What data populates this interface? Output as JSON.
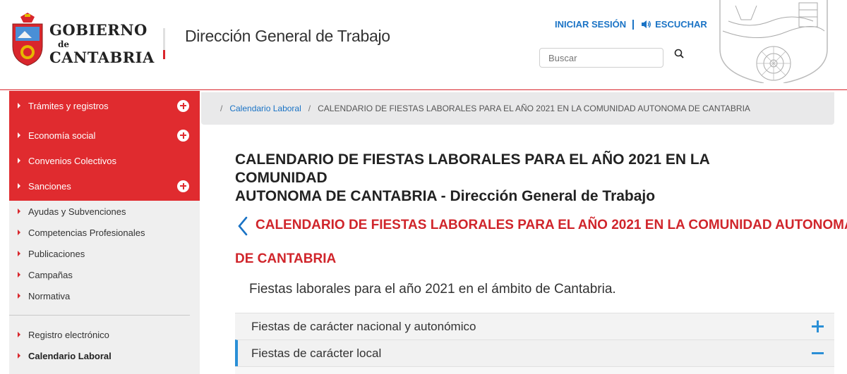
{
  "header": {
    "logo": {
      "line1": "GOBIERNO",
      "line2": "de",
      "line3": "CANTABRIA"
    },
    "department": "Dirección General de Trabajo",
    "login_label": "INICIAR SESIÓN",
    "listen_label": "ESCUCHAR",
    "search_placeholder": "Buscar",
    "accent_color": "#d9262c",
    "link_color": "#1a73c5"
  },
  "sidebar": {
    "red_items": [
      {
        "label": "Trámites y registros",
        "expandable": true
      },
      {
        "label": "Economía social",
        "expandable": true
      },
      {
        "label": "Convenios Colectivos",
        "expandable": false
      },
      {
        "label": "Sanciones",
        "expandable": true
      }
    ],
    "grey_items": [
      {
        "label": "Ayudas y Subvenciones"
      },
      {
        "label": "Competencias Profesionales"
      },
      {
        "label": "Publicaciones"
      },
      {
        "label": "Campañas"
      },
      {
        "label": "Normativa"
      }
    ],
    "bottom_items": [
      {
        "label": "Registro electrónico"
      },
      {
        "label": "Calendario Laboral",
        "active": true
      }
    ]
  },
  "breadcrumb": {
    "link": "Calendario Laboral",
    "current": "CALENDARIO DE FIESTAS LABORALES PARA EL AÑO 2021 EN LA COMUNIDAD AUTONOMA DE CANTABRIA"
  },
  "main": {
    "title_line1": "CALENDARIO DE FIESTAS LABORALES PARA EL AÑO 2021 EN LA COMUNIDAD",
    "title_line2": "AUTONOMA DE CANTABRIA - Dirección General de Trabajo",
    "subtitle_line1": "CALENDARIO DE FIESTAS LABORALES PARA EL AÑO 2021 EN LA COMUNIDAD AUTONOMA",
    "subtitle_line2": "DE CANTABRIA",
    "intro": "Fiestas laborales para el año 2021 en el ámbito de Cantabria."
  },
  "accordion": [
    {
      "label": "Fiestas de carácter nacional y autonómico",
      "expanded": false
    },
    {
      "label": "Fiestas de carácter local",
      "expanded": true
    }
  ]
}
